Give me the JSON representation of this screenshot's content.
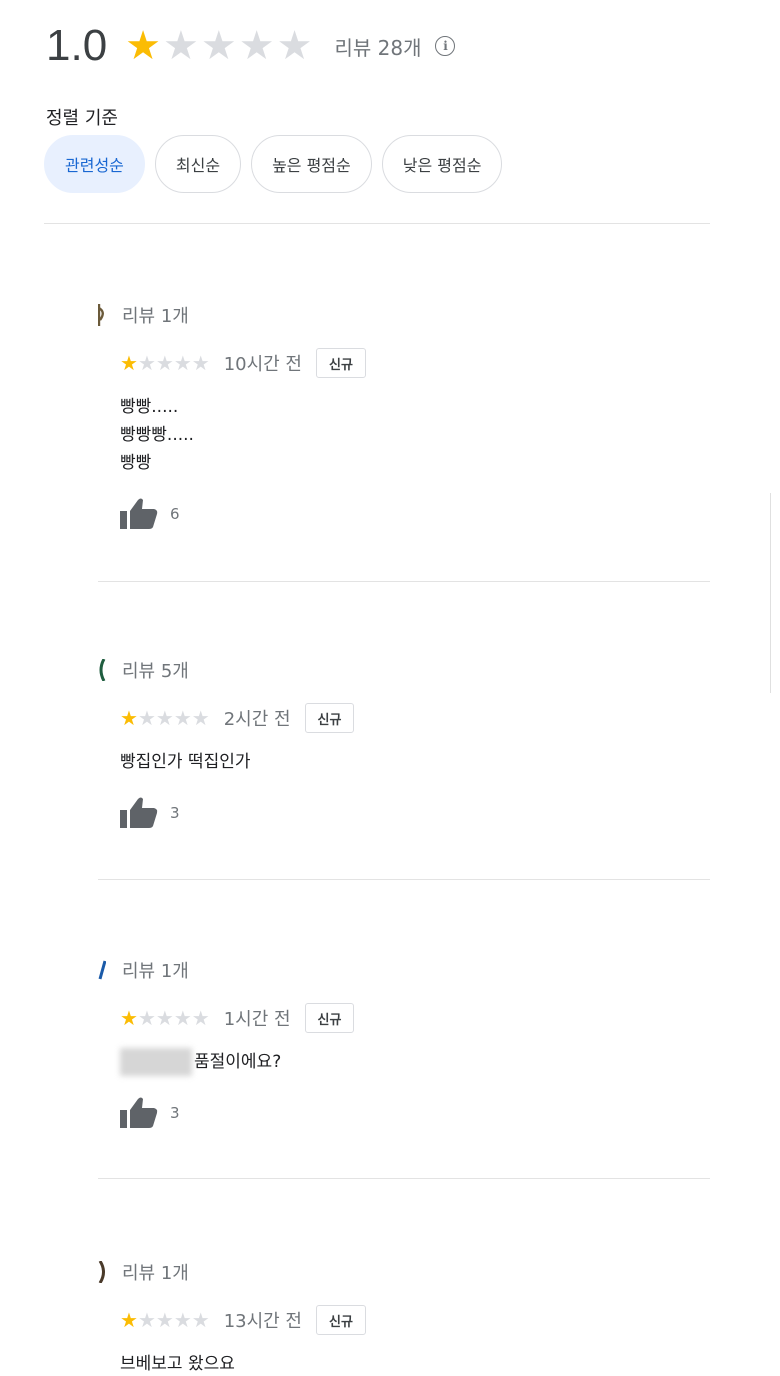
{
  "summary": {
    "score": "1.0",
    "rating": 1,
    "max_rating": 5,
    "review_count": "리뷰 28개",
    "info_icon": "info-icon"
  },
  "sort": {
    "label": "정렬 기준",
    "options": [
      "관련성순",
      "최신순",
      "높은 평점순",
      "낮은 평점순"
    ],
    "selected": "관련성순"
  },
  "colors": {
    "star_on": "#fbbc04",
    "star_off": "#dadce0",
    "chip_active_bg": "#e8f0fe",
    "chip_active_text": "#1967d2"
  },
  "reviews": [
    {
      "reviewer_meta": "리뷰 1개",
      "rating": 1,
      "time": "10시간 전",
      "badge": "신규",
      "text_lines": [
        "빵빵.....",
        "빵빵빵.....",
        "빵빵"
      ],
      "likes": "6",
      "avatar_color": "#6b5a3a"
    },
    {
      "reviewer_meta": "리뷰 5개",
      "rating": 1,
      "time": "2시간 전",
      "badge": "신규",
      "text_lines": [
        "빵집인가 떡집인가"
      ],
      "likes": "3",
      "avatar_color": "#1f5d3f"
    },
    {
      "reviewer_meta": "리뷰 1개",
      "rating": 1,
      "time": "1시간 전",
      "badge": "신규",
      "text_lines": [
        "품절이에요?"
      ],
      "has_blurred_prefix": true,
      "likes": "3",
      "avatar_color": "#1a5aa8"
    },
    {
      "reviewer_meta": "리뷰 1개",
      "rating": 1,
      "time": "13시간 전",
      "badge": "신규",
      "text_lines": [
        "브베보고 왔으요"
      ],
      "likes": "",
      "avatar_color": "#4a3a2a"
    }
  ]
}
